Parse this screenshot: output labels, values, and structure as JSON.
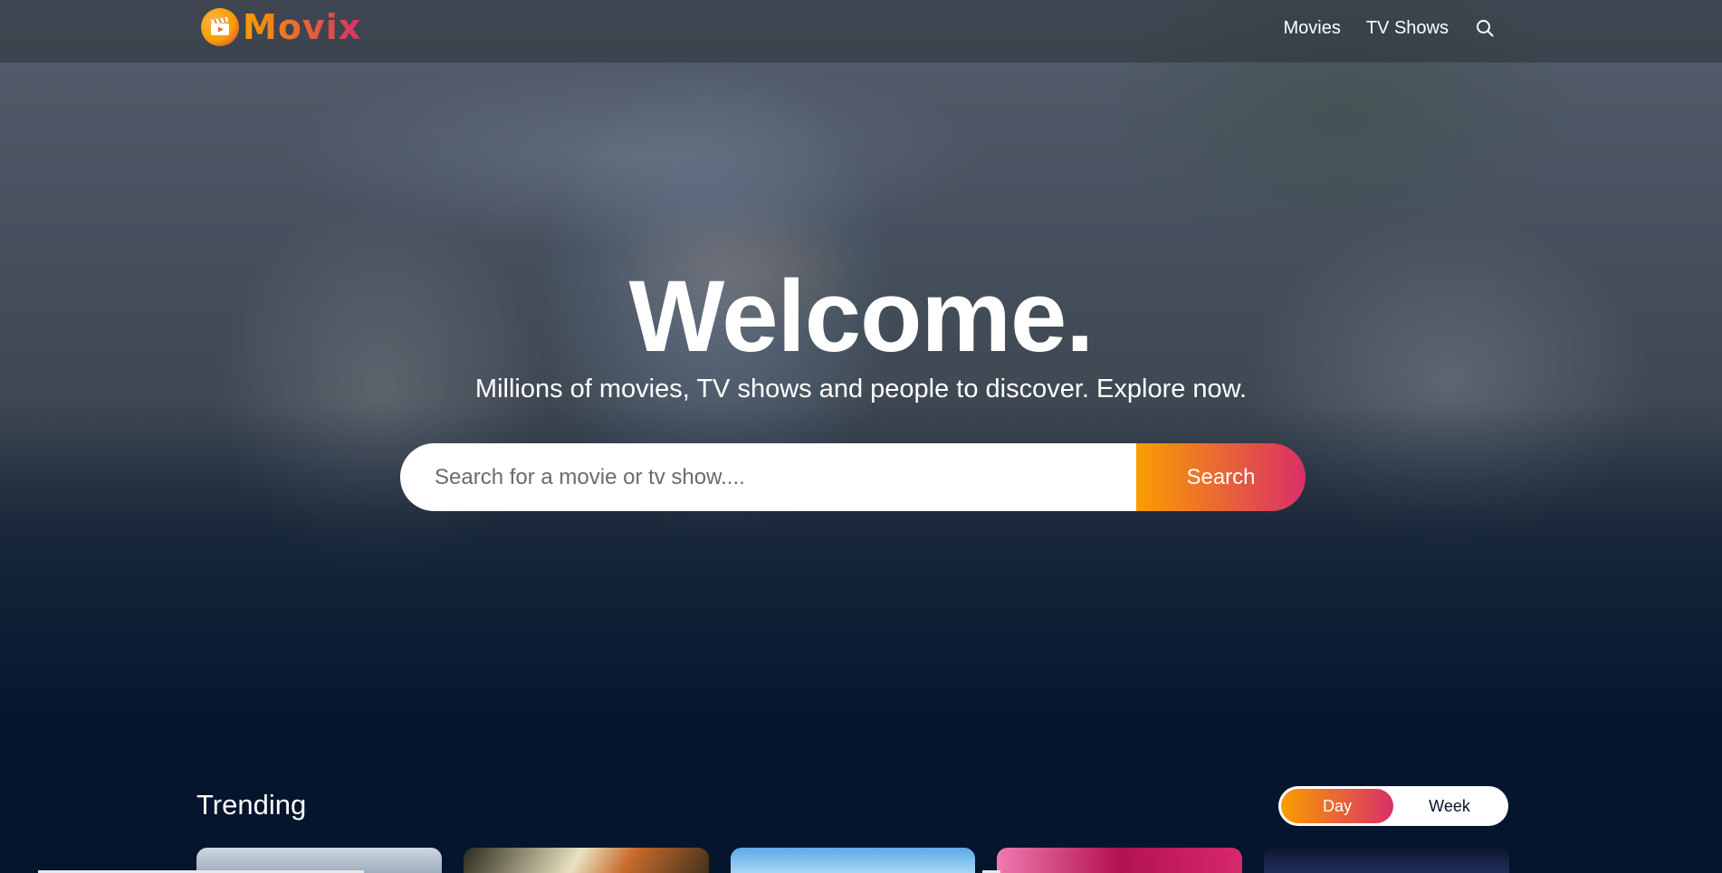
{
  "header": {
    "logo_text": "Movix",
    "nav": {
      "movies": "Movies",
      "tv_shows": "TV Shows"
    },
    "search_icon": "search-icon"
  },
  "hero": {
    "title": "Welcome.",
    "subtitle": "Millions of movies, TV shows and people to discover. Explore now.",
    "search": {
      "placeholder": "Search for a movie or tv show....",
      "value": "",
      "button_label": "Search"
    }
  },
  "trending": {
    "title": "Trending",
    "tabs": [
      "Day",
      "Week"
    ],
    "active_tab": "Day"
  },
  "colors": {
    "background": "#04152d",
    "accent_start": "#f89e00",
    "accent_end": "#da2f68"
  }
}
